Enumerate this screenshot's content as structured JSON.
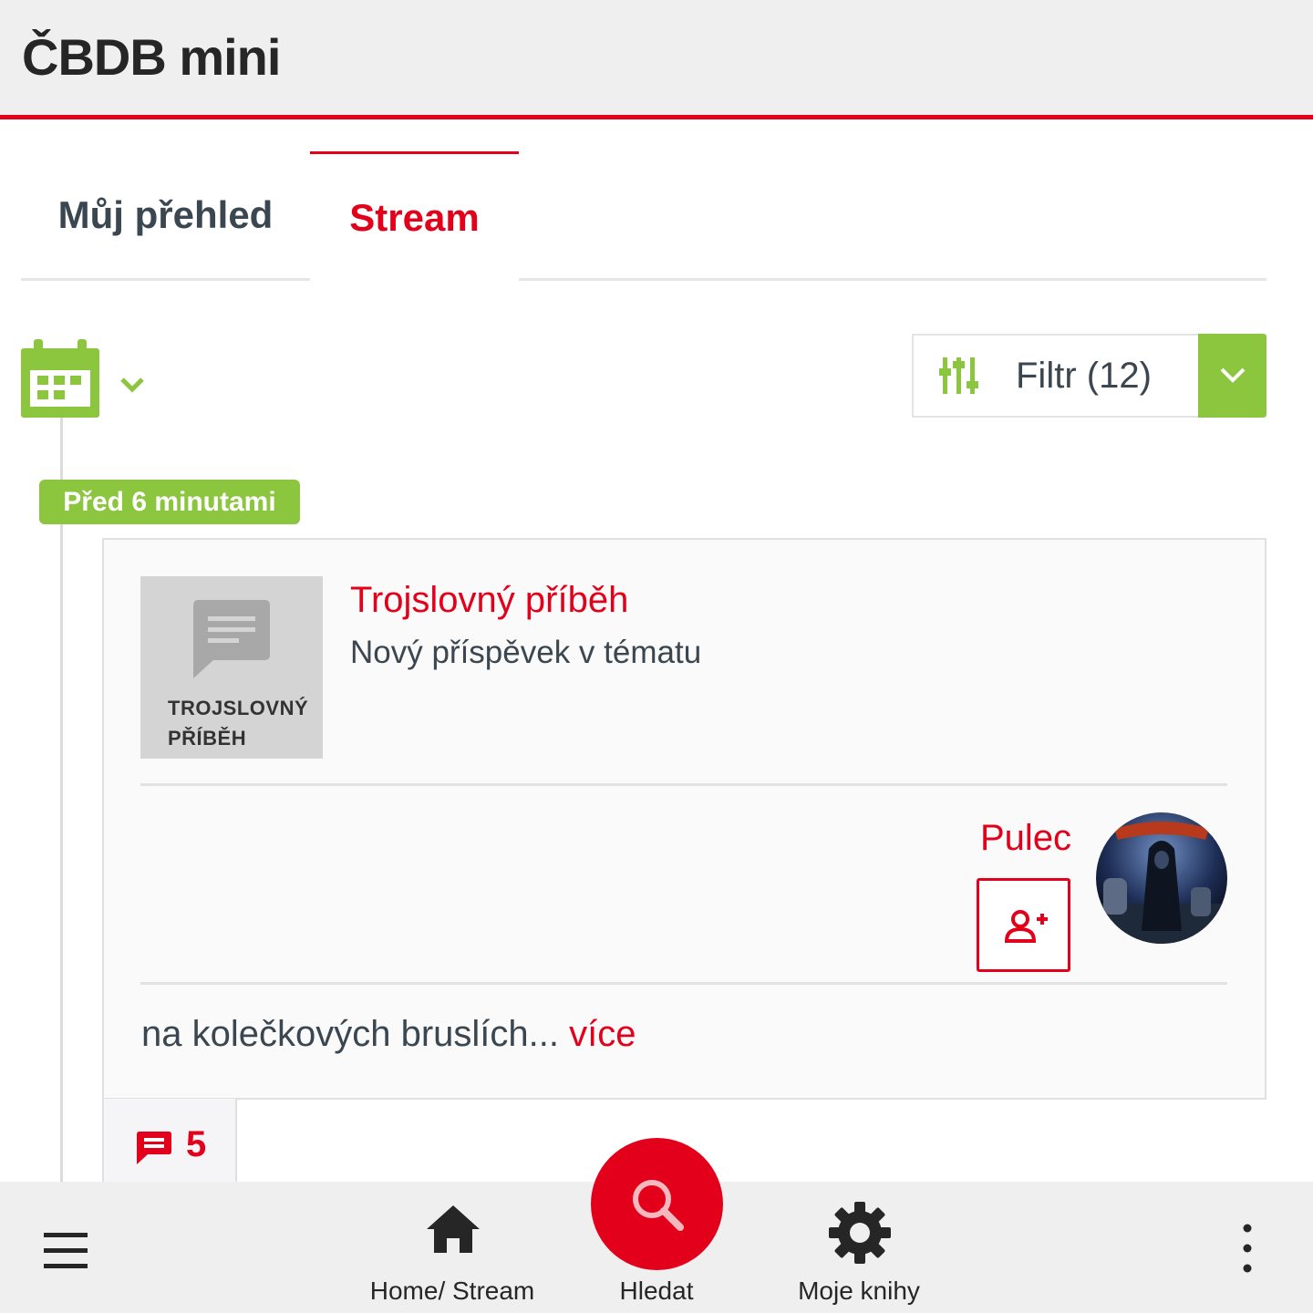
{
  "app": {
    "title": "ČBDB mini"
  },
  "tabs": [
    {
      "label": "Můj přehled",
      "active": false
    },
    {
      "label": "Stream",
      "active": true
    }
  ],
  "filter": {
    "label": "Filtr (12)",
    "icon": "sliders-icon"
  },
  "timeline": {
    "time_badge": "Před 6 minutami"
  },
  "post": {
    "thumb_label": "TROJSLOVNÝ PŘÍBĚH",
    "title": "Trojslovný příběh",
    "subtitle": "Nový příspěvek v tématu",
    "user": "Pulec",
    "excerpt": "na kolečkových bruslích...",
    "more": "více",
    "comment_count": "5"
  },
  "bottom_nav": {
    "home": "Home/ Stream",
    "search": "Hledat",
    "books": "Moje knihy"
  },
  "colors": {
    "accent": "#e3001b",
    "green": "#8cc63f",
    "text": "#3b4750"
  }
}
